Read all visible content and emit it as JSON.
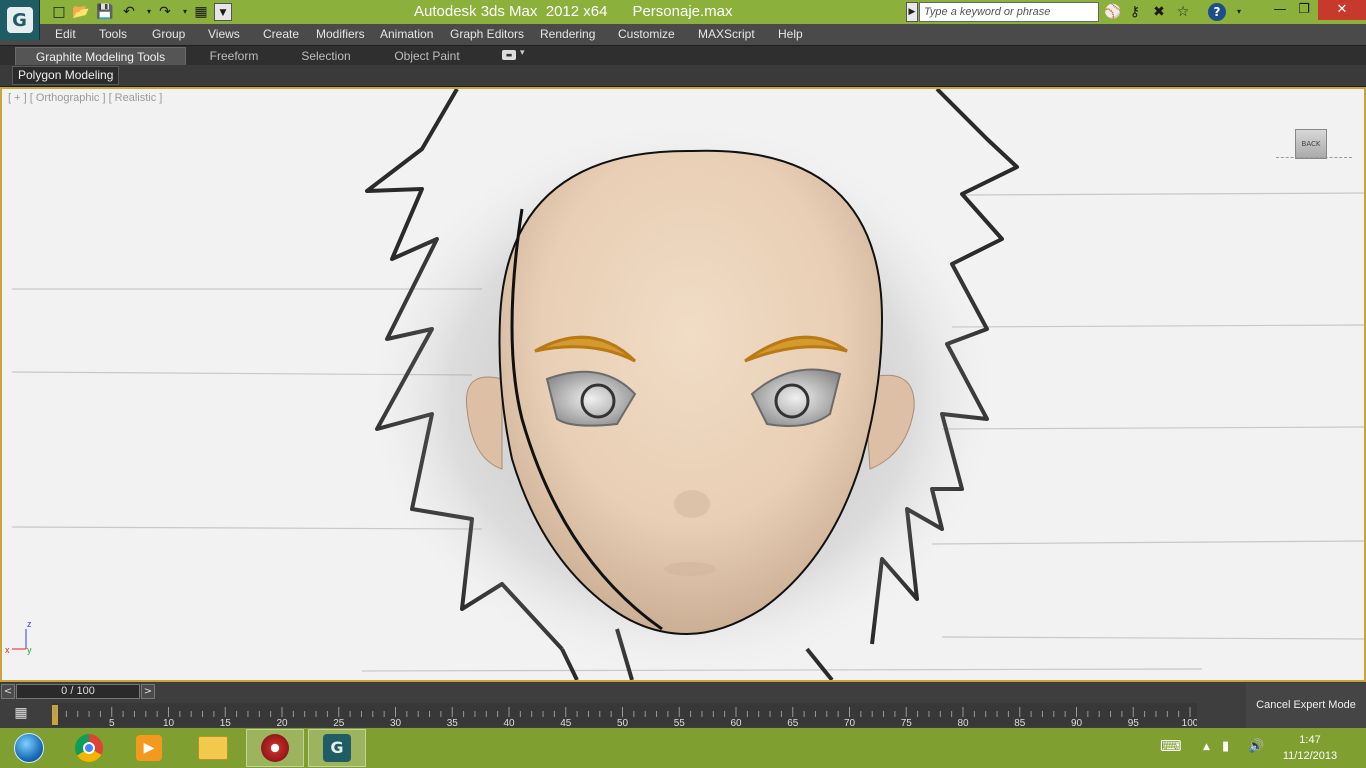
{
  "titlebar": {
    "title": "Autodesk 3ds Max  2012 x64      Personaje.max",
    "search_placeholder": "Type a keyword or phrase"
  },
  "menu": [
    "Edit",
    "Tools",
    "Group",
    "Views",
    "Create",
    "Modifiers",
    "Animation",
    "Graph Editors",
    "Rendering",
    "Customize",
    "MAXScript",
    "Help"
  ],
  "ribbon": {
    "tabs": [
      "Graphite Modeling Tools",
      "Freeform",
      "Selection",
      "Object Paint"
    ],
    "panel": "Polygon Modeling"
  },
  "viewport": {
    "label": "[ + ] [ Orthographic ] [ Realistic ]",
    "viewcube": "BACK",
    "axis": {
      "z": "z",
      "x": "x",
      "y": "y"
    }
  },
  "timeline": {
    "frame": "0 / 100",
    "ticks": [
      "5",
      "10",
      "15",
      "20",
      "25",
      "30",
      "35",
      "40",
      "45",
      "50",
      "55",
      "60",
      "65",
      "70",
      "75",
      "80",
      "85",
      "90",
      "95",
      "100"
    ]
  },
  "cancel_expert": "Cancel Expert Mode",
  "taskbar": {
    "time": "1:47",
    "date": "11/12/2013"
  }
}
